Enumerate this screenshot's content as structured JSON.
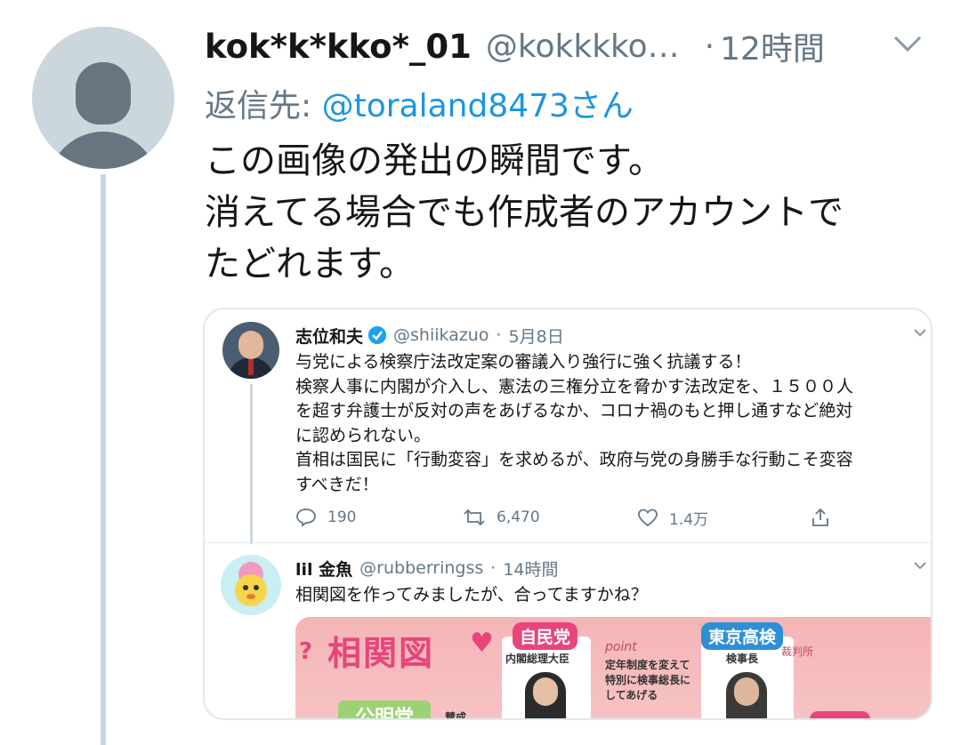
{
  "tweet": {
    "display_name": "kok*k*kko*_01",
    "handle": "@kokkkko…",
    "separator": "·",
    "time": "12時間",
    "reply_prefix": "返信先: ",
    "reply_to": "@toraland8473さん",
    "text_lines": [
      "この画像の発出の瞬間です。",
      "消えてる場合でも作成者のアカウントで",
      "たどれます。"
    ]
  },
  "embedded": {
    "original": {
      "name": "志位和夫",
      "handle": "@shiikazuo",
      "separator": "·",
      "date": "5月8日",
      "text_lines": [
        "与党による検察庁法改定案の審議入り強行に強く抗議する！",
        "検察人事に内閣が介入し、憲法の三権分立を脅かす法改定を、１５００人",
        "を超す弁護士が反対の声をあげるなか、コロナ禍のもと押し通すなど絶対",
        "に認められない。",
        "首相は国民に「行動変容」を求めるが、政府与党の身勝手な行動こそ変容",
        "すべきだ！"
      ],
      "replies": "190",
      "retweets": "6,470",
      "likes": "1.4万"
    },
    "reply": {
      "name": "lil 金魚",
      "handle": "@rubberringss",
      "separator": "·",
      "time": "14時間",
      "text": "相関図を作ってみましたが、合ってますかね？",
      "image": {
        "title": "相関図",
        "q": "?",
        "label_a": "自民党",
        "sub_a": "内閣総理大臣",
        "point": "point",
        "note_lines": [
          "定年制度を変えて",
          "特別に検事総長に",
          "してあげる"
        ],
        "label_b": "東京高検",
        "sub_b": "検事長",
        "stamp": "裁判所",
        "green_label": "公明党",
        "small_label": "賛成"
      }
    }
  },
  "colors": {
    "link": "#1b95e0",
    "muted": "#657786",
    "verified": "#1da1f2",
    "thread_line": "#ccd6dd"
  },
  "icons": [
    "default-avatar-icon",
    "chevron-down-icon",
    "verified-badge-icon",
    "reply-icon",
    "retweet-icon",
    "like-icon",
    "share-icon"
  ]
}
